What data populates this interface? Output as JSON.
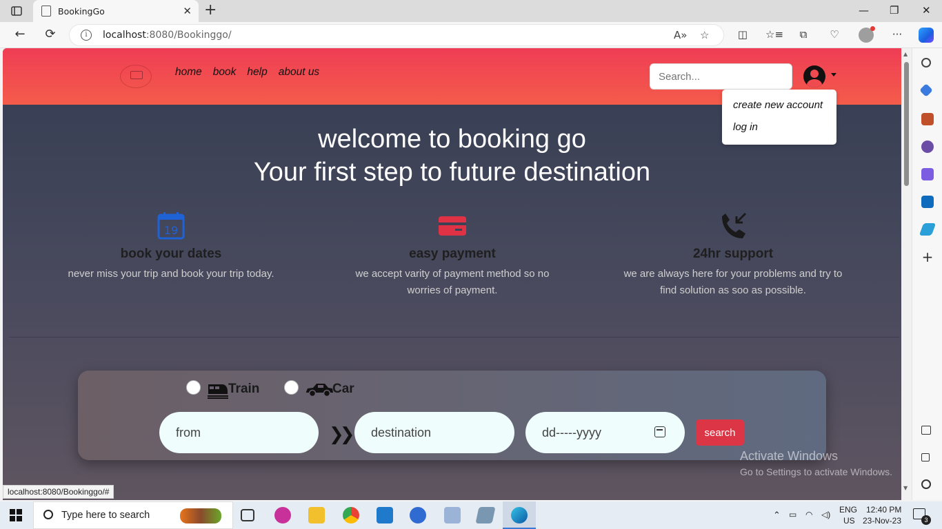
{
  "browser": {
    "tab_title": "BookingGo",
    "tab_close": "✕",
    "new_tab": "+",
    "url_host": "localhost",
    "url_rest": ":8080/Bookinggo/",
    "window_controls": {
      "minimize": "—",
      "maximize": "❐",
      "close": "✕"
    },
    "nav": {
      "back": "←",
      "reload": "⟳"
    },
    "toolbar": {
      "read_aloud": "A»",
      "favorite": "☆",
      "split": "◫",
      "favorites": "☆≡",
      "collections": "⧉",
      "health": "♡",
      "more": "···"
    },
    "status_url": "localhost:8080/Bookinggo/#"
  },
  "header": {
    "nav": [
      "home",
      "book",
      "help",
      "about us"
    ],
    "search_placeholder": "Search...",
    "dropdown": [
      "create new account",
      "log in"
    ]
  },
  "hero": {
    "line1": "welcome to booking go",
    "line2": "Your first step to future destination"
  },
  "features": [
    {
      "icon": "calendar-icon",
      "icon_text": "19",
      "title": "book your dates",
      "desc": "never miss your trip and book your trip today."
    },
    {
      "icon": "credit-card-icon",
      "title": "easy payment",
      "desc": "we accept varity of payment method so no worries of payment."
    },
    {
      "icon": "phone-incoming-icon",
      "title": "24hr support",
      "desc": "we are always here for your problems and try to find solution as soo as possible."
    }
  ],
  "booking": {
    "vehicle_options": [
      "Train",
      "Car"
    ],
    "from_placeholder": "from",
    "destination_placeholder": "destination",
    "date_placeholder": "dd-----yyyy",
    "search_button": "search"
  },
  "watermark": {
    "line1": "Activate Windows",
    "line2": "Go to Settings to activate Windows."
  },
  "taskbar": {
    "search_placeholder": "Type here to search",
    "lang": "ENG",
    "region": "US",
    "time": "12:40 PM",
    "date": "23-Nov-23",
    "notifications": "3"
  },
  "colors": {
    "header_gradient_top": "#ef3d55",
    "header_gradient_bottom": "#f45c4a",
    "search_button": "#dc3545",
    "calendar_icon": "#1e62d6",
    "card_icon": "#e03245"
  }
}
